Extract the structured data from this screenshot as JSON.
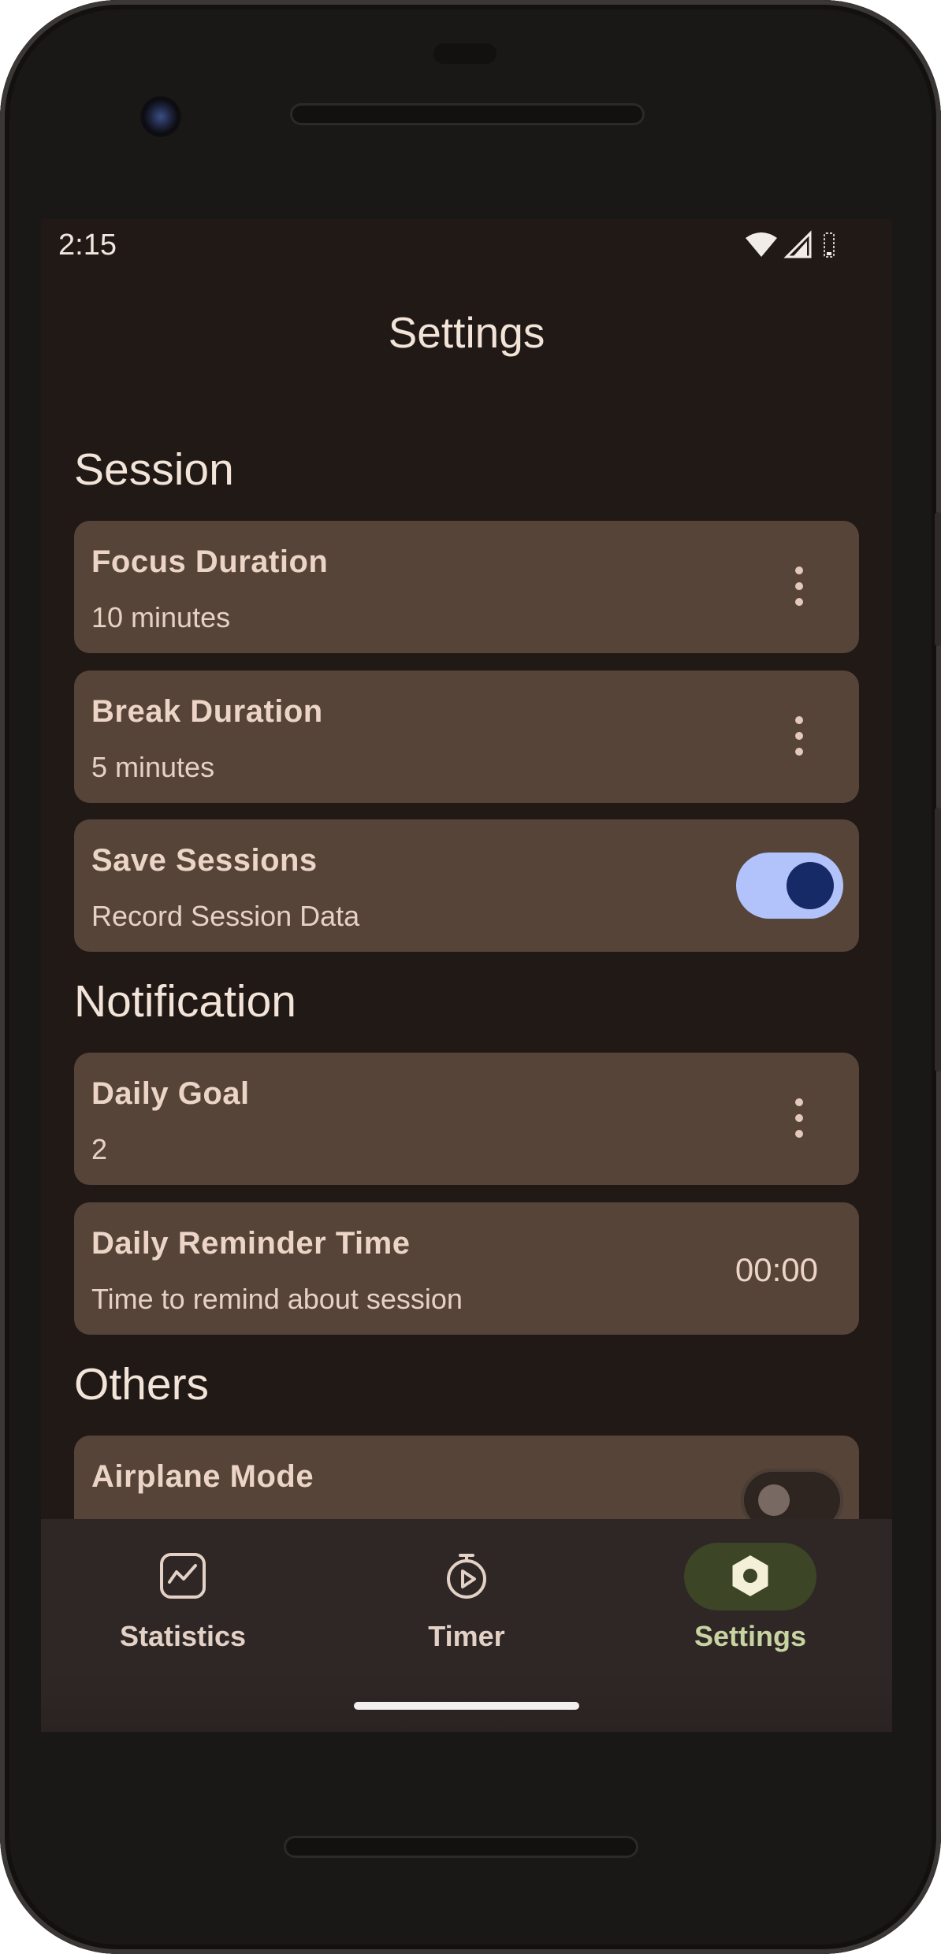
{
  "status_bar": {
    "time": "2:15"
  },
  "header": {
    "title": "Settings"
  },
  "sections": {
    "session": {
      "heading": "Session",
      "focus_duration": {
        "title": "Focus Duration",
        "subtitle": "10 minutes"
      },
      "break_duration": {
        "title": "Break Duration",
        "subtitle": "5 minutes"
      },
      "save_sessions": {
        "title": "Save Sessions",
        "subtitle": "Record Session Data",
        "enabled": true
      }
    },
    "notification": {
      "heading": "Notification",
      "daily_goal": {
        "title": "Daily Goal",
        "subtitle": "2"
      },
      "daily_reminder": {
        "title": "Daily Reminder Time",
        "subtitle": "Time to remind about session",
        "value": "00:00"
      }
    },
    "others": {
      "heading": "Others",
      "airplane_mode": {
        "title": "Airplane Mode",
        "enabled": false
      }
    }
  },
  "bottom_nav": {
    "items": [
      {
        "label": "Statistics",
        "icon": "chart-icon",
        "active": false
      },
      {
        "label": "Timer",
        "icon": "stopwatch-icon",
        "active": false
      },
      {
        "label": "Settings",
        "icon": "settings-icon",
        "active": true
      }
    ]
  },
  "colors": {
    "background": "#211915",
    "card": "#564439",
    "toggle_on_track": "#b2c2fa",
    "toggle_on_knob": "#152a66",
    "nav_active_pill": "#3c4626",
    "nav_active_label": "#c8d3a2"
  }
}
